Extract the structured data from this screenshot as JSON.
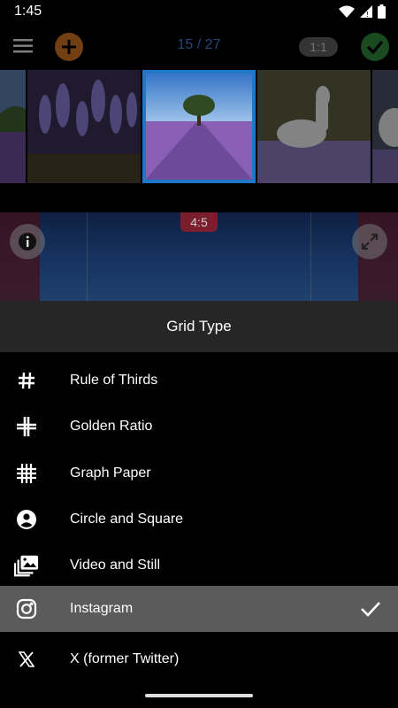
{
  "status_bar": {
    "time": "1:45",
    "icons": [
      "wifi-icon",
      "signal-icon",
      "battery-icon"
    ]
  },
  "toolbar": {
    "counter": "15 / 27",
    "ratio_label": "1:1",
    "menu_icon": "hamburger-menu-icon",
    "add_icon": "plus-icon",
    "confirm_icon": "checkmark-icon",
    "colors": {
      "add": "#b8671f",
      "confirm": "#2a7a35",
      "counter": "#3b73c7"
    }
  },
  "thumbnails": [
    {
      "subject": "lavender field landscape",
      "selected": false
    },
    {
      "subject": "lavender close-up",
      "selected": false
    },
    {
      "subject": "tree in lavender field",
      "selected": true
    },
    {
      "subject": "white horse in lavender",
      "selected": false
    },
    {
      "subject": "white horse",
      "selected": false
    }
  ],
  "preview": {
    "crop_ratio": "4:5",
    "info_icon": "info-icon",
    "expand_icon": "expand-icon"
  },
  "sheet": {
    "title": "Grid Type",
    "items": [
      {
        "label": "Rule of Thirds",
        "icon": "hash-icon",
        "selected": false
      },
      {
        "label": "Golden Ratio",
        "icon": "golden-grid-icon",
        "selected": false
      },
      {
        "label": "Graph Paper",
        "icon": "graph-grid-icon",
        "selected": false
      },
      {
        "label": "Circle and Square",
        "icon": "person-circle-icon",
        "selected": false
      },
      {
        "label": "Video and Still",
        "icon": "photo-library-icon",
        "selected": false
      },
      {
        "label": "Instagram",
        "icon": "instagram-icon",
        "selected": true
      },
      {
        "label": "X (former Twitter)",
        "icon": "x-logo-icon",
        "selected": false
      }
    ]
  }
}
